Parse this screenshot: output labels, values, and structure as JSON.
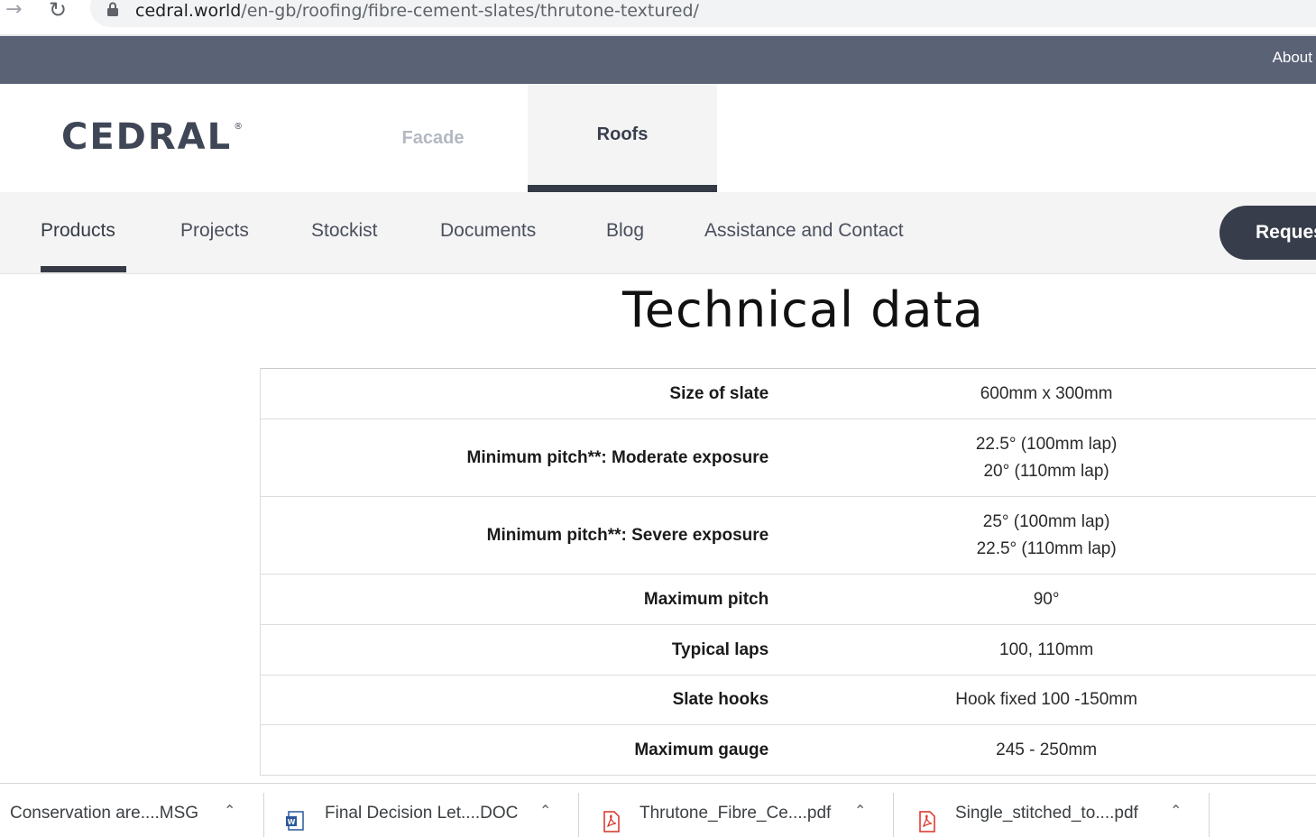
{
  "browser": {
    "url_host": "cedral.world",
    "url_path": "/en-gb/roofing/fibre-cement-slates/thrutone-textured/"
  },
  "topbar": {
    "about_label": "About"
  },
  "header": {
    "logo_text": "CEDRAL",
    "logo_mark": "®",
    "tabs": [
      {
        "label": "Facade"
      },
      {
        "label": "Roofs"
      }
    ]
  },
  "subnav": {
    "items": [
      {
        "label": "Products"
      },
      {
        "label": "Projects"
      },
      {
        "label": "Stockist"
      },
      {
        "label": "Documents"
      },
      {
        "label": "Blog"
      },
      {
        "label": "Assistance and Contact"
      }
    ],
    "request_label": "Request a sample"
  },
  "main": {
    "title": "Technical data",
    "rows": [
      {
        "label": "Size of slate",
        "values": [
          "600mm x 300mm"
        ]
      },
      {
        "label": "Minimum pitch**: Moderate exposure",
        "values": [
          "22.5° (100mm lap)",
          "20° (110mm lap)"
        ]
      },
      {
        "label": "Minimum pitch**: Severe exposure",
        "values": [
          "25° (100mm lap)",
          "22.5° (110mm lap)"
        ]
      },
      {
        "label": "Maximum pitch",
        "values": [
          "90°"
        ]
      },
      {
        "label": "Typical laps",
        "values": [
          "100, 110mm"
        ]
      },
      {
        "label": "Slate hooks",
        "values": [
          "Hook fixed 100 -150mm"
        ]
      },
      {
        "label": "Maximum gauge",
        "values": [
          "245 - 250mm"
        ]
      }
    ]
  },
  "downloads": [
    {
      "name": "Conservation are....MSG",
      "icon": "msg-file-icon"
    },
    {
      "name": "Final Decision Let....DOC",
      "icon": "word-doc-icon"
    },
    {
      "name": "Thrutone_Fibre_Ce....pdf",
      "icon": "pdf-icon"
    },
    {
      "name": "Single_stitched_to....pdf",
      "icon": "pdf-icon"
    }
  ],
  "colors": {
    "topbar": "#5a6275",
    "accent_dark": "#373d4a",
    "pdf_red": "#d93025",
    "word_blue": "#2b579a"
  }
}
